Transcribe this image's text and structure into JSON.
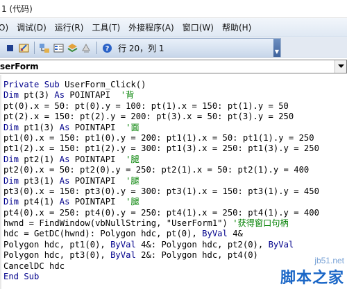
{
  "window": {
    "title": "1 (代码)"
  },
  "menubar": {
    "items": [
      {
        "label": "O)"
      },
      {
        "label": "调试(D)"
      },
      {
        "label": "运行(R)"
      },
      {
        "label": "工具(T)"
      },
      {
        "label": "外接程序(A)"
      },
      {
        "label": "窗口(W)"
      },
      {
        "label": "帮助(H)"
      }
    ]
  },
  "toolbar": {
    "position_text": "行 20，列 1",
    "icons": [
      "stop-icon",
      "design-mode-icon",
      "project-explorer-icon",
      "properties-icon",
      "object-browser-icon",
      "toolbox-icon",
      "help-icon"
    ]
  },
  "object_box": {
    "value": "serForm"
  },
  "code": {
    "lines": [
      [
        [
          "kw",
          "Private Sub "
        ],
        [
          "t",
          "UserForm_Click()"
        ]
      ],
      [
        [
          "kw",
          "Dim "
        ],
        [
          "t",
          "pt(3) "
        ],
        [
          "kw",
          "As "
        ],
        [
          "t",
          "POINTAPI  "
        ],
        [
          "cm",
          "'背"
        ]
      ],
      [
        [
          "t",
          "pt(0).x = 50: pt(0).y = 100: pt(1).x = 150: pt(1).y = 50"
        ]
      ],
      [
        [
          "t",
          "pt(2).x = 150: pt(2).y = 200: pt(3).x = 50: pt(3).y = 250"
        ]
      ],
      [
        [
          "kw",
          "Dim "
        ],
        [
          "t",
          "pt1(3) "
        ],
        [
          "kw",
          "As "
        ],
        [
          "t",
          "POINTAPI  "
        ],
        [
          "cm",
          "'面"
        ]
      ],
      [
        [
          "t",
          "pt1(0).x = 150: pt1(0).y = 200: pt1(1).x = 50: pt1(1).y = 250"
        ]
      ],
      [
        [
          "t",
          "pt1(2).x = 150: pt1(2).y = 300: pt1(3).x = 250: pt1(3).y = 250"
        ]
      ],
      [
        [
          "kw",
          "Dim "
        ],
        [
          "t",
          "pt2(1) "
        ],
        [
          "kw",
          "As "
        ],
        [
          "t",
          "POINTAPI  "
        ],
        [
          "cm",
          "'腿"
        ]
      ],
      [
        [
          "t",
          "pt2(0).x = 50: pt2(0).y = 250: pt2(1).x = 50: pt2(1).y = 400"
        ]
      ],
      [
        [
          "kw",
          "Dim "
        ],
        [
          "t",
          "pt3(1) "
        ],
        [
          "kw",
          "As "
        ],
        [
          "t",
          "POINTAPI  "
        ],
        [
          "cm",
          "'腿"
        ]
      ],
      [
        [
          "t",
          "pt3(0).x = 150: pt3(0).y = 300: pt3(1).x = 150: pt3(1).y = 450"
        ]
      ],
      [
        [
          "kw",
          "Dim "
        ],
        [
          "t",
          "pt4(1) "
        ],
        [
          "kw",
          "As "
        ],
        [
          "t",
          "POINTAPI  "
        ],
        [
          "cm",
          "'腿"
        ]
      ],
      [
        [
          "t",
          "pt4(0).x = 250: pt4(0).y = 250: pt4(1).x = 250: pt4(1).y = 400"
        ]
      ],
      [
        [
          "t",
          "hwnd = FindWindow(vbNullString, \"UserForm1\") "
        ],
        [
          "cm",
          "'获得窗口句柄"
        ]
      ],
      [
        [
          "t",
          "hdc = GetDC(hwnd): Polygon hdc, pt(0), "
        ],
        [
          "kw",
          "ByVal "
        ],
        [
          "t",
          "4&"
        ]
      ],
      [
        [
          "t",
          "Polygon hdc, pt1(0), "
        ],
        [
          "kw",
          "ByVal "
        ],
        [
          "t",
          "4&: Polygon hdc, pt2(0), "
        ],
        [
          "kw",
          "ByVal"
        ]
      ],
      [
        [
          "t",
          "Polygon hdc, pt3(0), "
        ],
        [
          "kw",
          "ByVal "
        ],
        [
          "t",
          "2&: Polygon hdc, pt4(0)"
        ]
      ],
      [
        [
          "t",
          "CancelDC hdc"
        ]
      ],
      [
        [
          "kw",
          "End Sub"
        ]
      ]
    ]
  },
  "watermark": {
    "site": "jb51.net",
    "name": "脚本之家"
  },
  "colors": {
    "keyword": "#00008b",
    "comment": "#008000",
    "text": "#000000"
  }
}
